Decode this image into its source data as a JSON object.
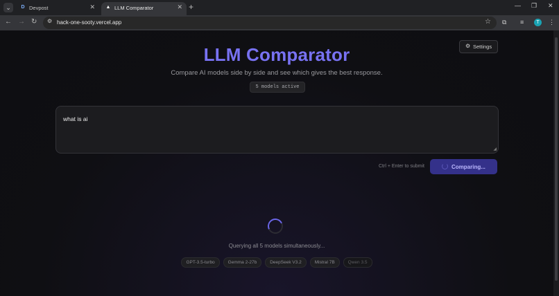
{
  "browser": {
    "tabs": [
      {
        "favicon": "D",
        "title": "Devpost"
      },
      {
        "favicon": "▲",
        "title": "LLM Comparator"
      }
    ],
    "url": "hack-one-sooty.vercel.app",
    "profile_initial": "T"
  },
  "app": {
    "settings_label": "Settings",
    "title": "LLM Comparator",
    "subtitle": "Compare AI models side by side and see which gives the best response.",
    "models_badge": "5 models active",
    "prompt_value": "what is ai",
    "submit_hint": "Ctrl + Enter to submit",
    "compare_button": "Comparing...",
    "status_text": "Querying all 5 models simultaneously...",
    "models": [
      "GPT-3.5-turbo",
      "Gemma 2-27b",
      "DeepSeek V3.2",
      "Mistral 7B",
      "Qwen 3.5"
    ]
  },
  "colors": {
    "accent": "#7872f2",
    "button_bg": "#34318a",
    "background": "#0e0e11"
  }
}
